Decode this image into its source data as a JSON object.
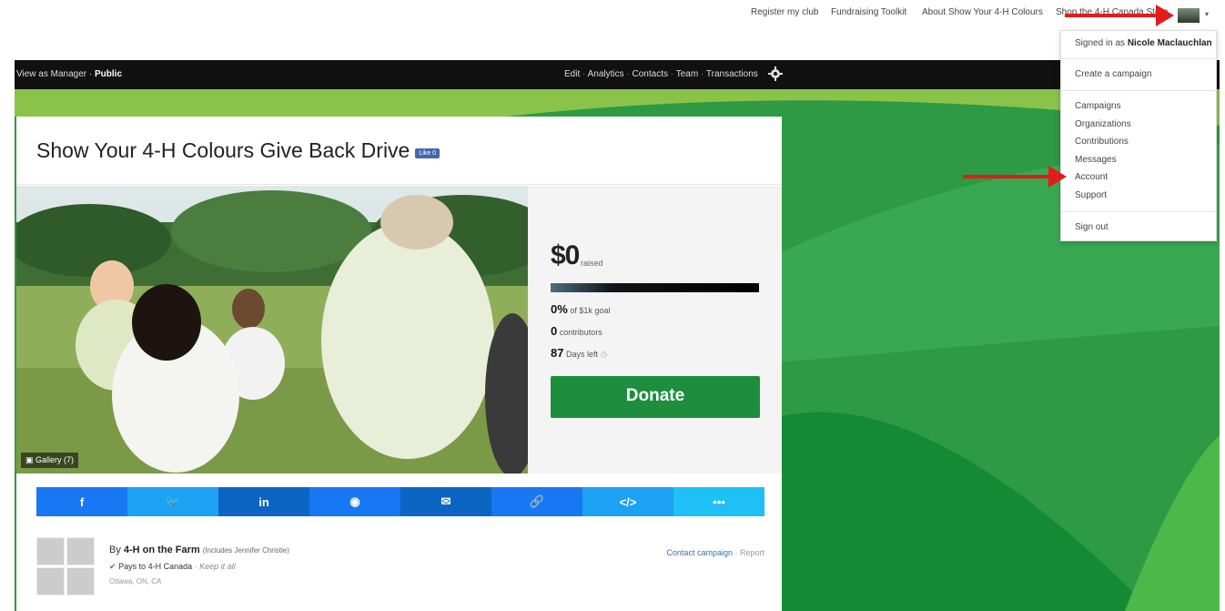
{
  "top_nav": {
    "links": [
      "Register my club",
      "Fundraising Toolkit",
      "About Show Your 4-H Colours",
      "Shop the 4-H Canada Store"
    ]
  },
  "manager_bar": {
    "view_as_label": "View as",
    "manager": "Manager",
    "sep": "·",
    "public": "Public",
    "links": [
      "Edit",
      "Analytics",
      "Contacts",
      "Team",
      "Transactions"
    ]
  },
  "campaign": {
    "title": "Show Your 4-H Colours Give Back Drive",
    "fb_like": "Like 0",
    "gallery": "Gallery (7)",
    "amount": "$0",
    "amount_label": "raised",
    "progress_fraction": 0,
    "percent": "0%",
    "percent_label": "of $1k goal",
    "contributors": "0",
    "contributors_label": "contributors",
    "days": "87",
    "days_label": "Days left",
    "donate_label": "Donate"
  },
  "share": {
    "buttons": [
      {
        "icon": "facebook-icon",
        "glyph": "f",
        "color": "#1877f2"
      },
      {
        "icon": "twitter-icon",
        "glyph": "🐦",
        "color": "#1da1f2"
      },
      {
        "icon": "linkedin-icon",
        "glyph": "in",
        "color": "#0a66c2"
      },
      {
        "icon": "messenger-icon",
        "glyph": "◉",
        "color": "#1877f2"
      },
      {
        "icon": "email-icon",
        "glyph": "✉",
        "color": "#0a66c2"
      },
      {
        "icon": "link-icon",
        "glyph": "🔗",
        "color": "#1877f2"
      },
      {
        "icon": "embed-icon",
        "glyph": "</>",
        "color": "#1da1f2"
      },
      {
        "icon": "more-icon",
        "glyph": "•••",
        "color": "#1ec0f5"
      }
    ]
  },
  "owner": {
    "by": "By",
    "name": "4-H on the Farm",
    "includes": "(Includes Jennifer Christie)",
    "pays": "Pays to 4-H Canada",
    "keep": "Keep it all",
    "location": "Ottawa, ON, CA",
    "contact": "Contact campaign",
    "report": "Report"
  },
  "user_menu": {
    "signed_in_prefix": "Signed in as",
    "user_name": "Nicole Maclauchlan",
    "create": "Create a campaign",
    "items": [
      "Campaigns",
      "Organizations",
      "Contributions",
      "Messages",
      "Account",
      "Support"
    ],
    "sign_out": "Sign out"
  },
  "colors": {
    "accent_green": "#1e8e3e",
    "bg_green": "#2e9a44",
    "arrow_red": "#e31b1b"
  }
}
